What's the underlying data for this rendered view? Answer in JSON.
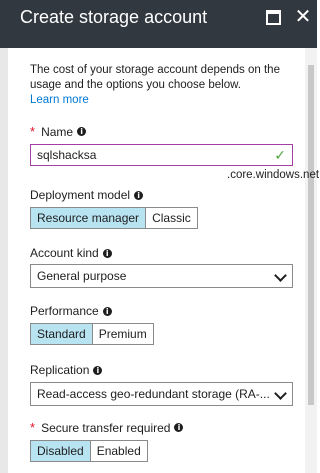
{
  "header": {
    "title": "Create storage account"
  },
  "description": {
    "text": "The cost of your storage account depends on the usage and the options you choose below.",
    "link": "Learn more"
  },
  "name_field": {
    "label": "Name",
    "value": "sqlshacksa",
    "suffix": ".core.windows.net"
  },
  "deployment_model": {
    "label": "Deployment model",
    "options": [
      "Resource manager",
      "Classic"
    ],
    "selected": "Resource manager"
  },
  "account_kind": {
    "label": "Account kind",
    "value": "General purpose"
  },
  "performance": {
    "label": "Performance",
    "options": [
      "Standard",
      "Premium"
    ],
    "selected": "Standard"
  },
  "replication": {
    "label": "Replication",
    "value": "Read-access geo-redundant storage (RA-..."
  },
  "secure_transfer": {
    "label": "Secure transfer required",
    "options": [
      "Disabled",
      "Enabled"
    ],
    "selected": "Disabled"
  },
  "colors": {
    "header_bg": "#32383f",
    "selected_option": "#b8e3f1",
    "link": "#0078d4",
    "required": "#e81123",
    "valid_check": "#4fa83d"
  }
}
